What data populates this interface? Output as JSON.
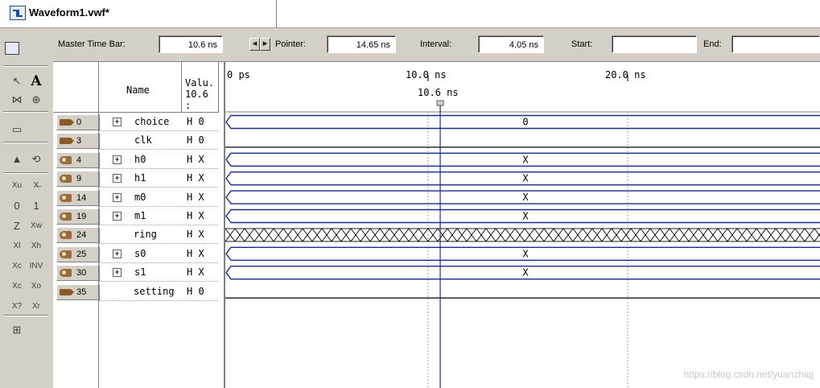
{
  "tab": {
    "title": "Waveform1.vwf*"
  },
  "toolbar": {
    "master_label": "Master Time Bar:",
    "master_value": "10.6 ns",
    "pointer_label": "Pointer:",
    "pointer_value": "14.65 ns",
    "interval_label": "Interval:",
    "interval_value": "4.05 ns",
    "start_label": "Start:",
    "start_value": "",
    "end_label": "End:",
    "end_value": ""
  },
  "palette": {
    "icons": [
      "select-tool-icon",
      "text-tool-icon",
      "waveform-edit-icon",
      "zoom-icon",
      "fullscreen-icon",
      "find-icon",
      "replace-icon",
      "uninitialized-icon",
      "forcing-unknown-icon",
      "force-low-icon",
      "force-high-icon",
      "high-impedance-icon",
      "weak-unknown-icon",
      "weak-low-icon",
      "weak-high-icon",
      "invert-icon",
      "count-value-icon",
      "clock-value-icon",
      "arbitrary-value-icon",
      "random-value-icon",
      "snap-to-grid-icon",
      "sort-icon"
    ]
  },
  "grid": {
    "header_name": "Name",
    "header_value_line1": "Valu.",
    "header_value_line2": "10.6 :"
  },
  "timeline": {
    "ticks": [
      "0 ps",
      "10.0 ns",
      "20.0 ns"
    ],
    "cursor_label": "10.6 ns"
  },
  "signals": [
    {
      "id": "0",
      "name": "choice",
      "value": "H 0",
      "kind": "in",
      "expandable": true,
      "wave": "bus",
      "wave_text": "0"
    },
    {
      "id": "3",
      "name": "clk",
      "value": "H 0",
      "kind": "in",
      "expandable": false,
      "wave": "low",
      "wave_text": ""
    },
    {
      "id": "4",
      "name": "h0",
      "value": "H X",
      "kind": "out",
      "expandable": true,
      "wave": "bus",
      "wave_text": "X"
    },
    {
      "id": "9",
      "name": "h1",
      "value": "H X",
      "kind": "out",
      "expandable": true,
      "wave": "bus",
      "wave_text": "X"
    },
    {
      "id": "14",
      "name": "m0",
      "value": "H X",
      "kind": "out",
      "expandable": true,
      "wave": "bus",
      "wave_text": "X"
    },
    {
      "id": "19",
      "name": "m1",
      "value": "H X",
      "kind": "out",
      "expandable": true,
      "wave": "bus",
      "wave_text": "X"
    },
    {
      "id": "24",
      "name": "ring",
      "value": "H X",
      "kind": "out",
      "expandable": false,
      "wave": "unknown",
      "wave_text": ""
    },
    {
      "id": "25",
      "name": "s0",
      "value": "H X",
      "kind": "out",
      "expandable": true,
      "wave": "bus",
      "wave_text": "X"
    },
    {
      "id": "30",
      "name": "s1",
      "value": "H X",
      "kind": "out",
      "expandable": true,
      "wave": "bus",
      "wave_text": "X"
    },
    {
      "id": "35",
      "name": "setting",
      "value": "H 0",
      "kind": "in",
      "expandable": false,
      "wave": "low",
      "wave_text": ""
    }
  ],
  "watermark": "https://blog.csdn.net/yuanzhiqj"
}
